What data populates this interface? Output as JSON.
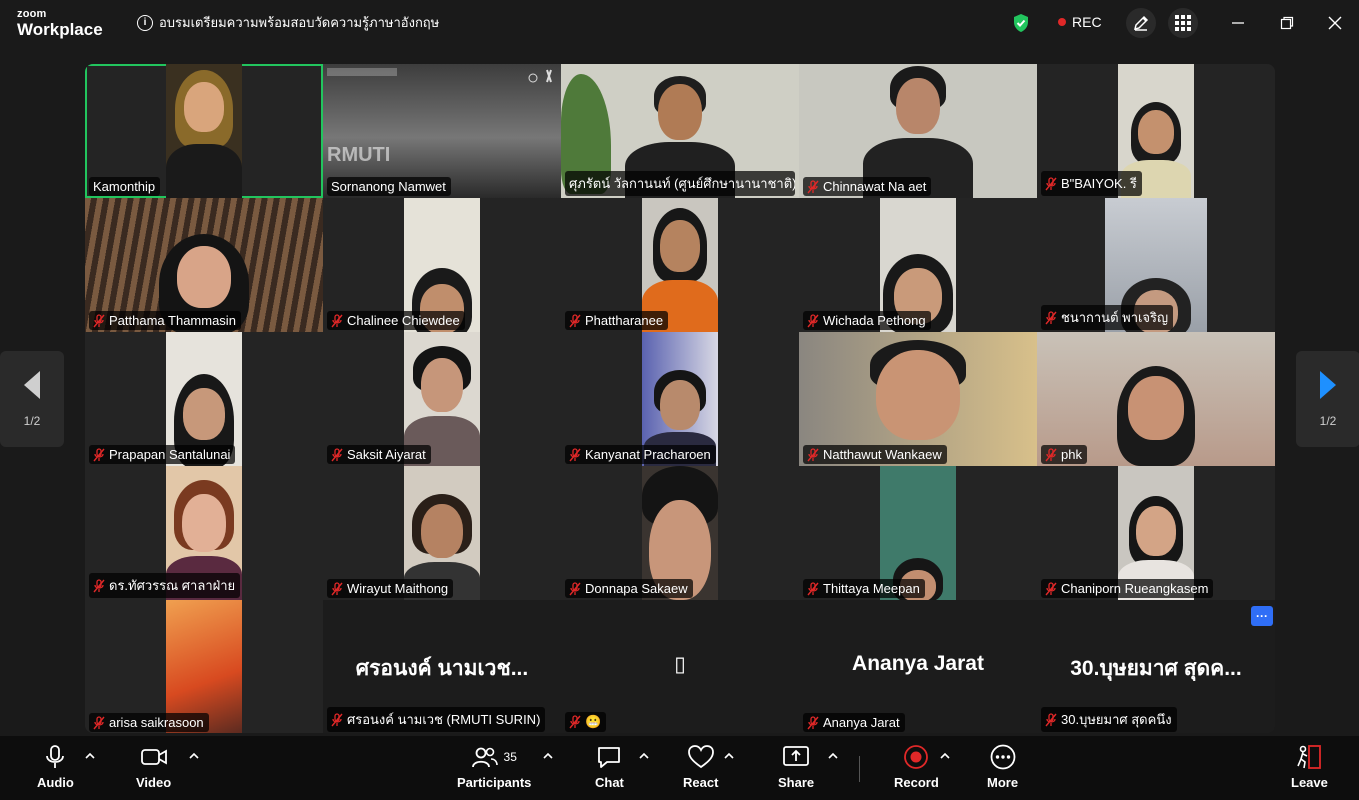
{
  "titlebar": {
    "logo_top": "zoom",
    "logo_bottom": "Workplace",
    "meeting_title": "อบรมเตรียมความพร้อมสอบวัดความรู้ภาษาอังกฤษ",
    "rec_label": "REC"
  },
  "pager": {
    "left_page": "1/2",
    "right_page": "1/2"
  },
  "participants": [
    {
      "name": "Kamonthip",
      "muted": false,
      "active": true
    },
    {
      "name": "Sornanong Namwet",
      "muted": false,
      "share_text": "RMUTI"
    },
    {
      "name": "ศุภรัตน์ วัลกานนท์ (ศูนย์ศึกษานานาชาติ)",
      "muted": false
    },
    {
      "name": "Chinnawat Na aet",
      "muted": true
    },
    {
      "name": "B\"BAIYOK. รี",
      "muted": true
    },
    {
      "name": "Patthama Thammasin",
      "muted": true
    },
    {
      "name": "Chalinee Chiewdee",
      "muted": true
    },
    {
      "name": "Phattharanee",
      "muted": true
    },
    {
      "name": "Wichada Pethong",
      "muted": true
    },
    {
      "name": "ชนากานต์ พาเจริญ",
      "muted": true
    },
    {
      "name": "Prapapan Santalunai",
      "muted": true
    },
    {
      "name": "Saksit Aiyarat",
      "muted": true
    },
    {
      "name": "Kanyanat Pracharoen",
      "muted": true
    },
    {
      "name": "Natthawut Wankaew",
      "muted": true
    },
    {
      "name": "phk",
      "muted": true
    },
    {
      "name": "ดร.ทัศวรรณ ศาลาฝ่าย",
      "muted": true
    },
    {
      "name": "Wirayut Maithong",
      "muted": true
    },
    {
      "name": "Donnapa Sakaew",
      "muted": true
    },
    {
      "name": "Thittaya Meepan",
      "muted": true
    },
    {
      "name": "Chaniporn Rueangkasem",
      "muted": true
    },
    {
      "name": "arisa saikrasoon",
      "muted": true
    },
    {
      "name": "ศรอนงค์ นามเวช (RMUTI SURIN)",
      "muted": true,
      "display_name": "ศรอนงค์ นามเวช..."
    },
    {
      "name": "😬",
      "muted": true,
      "display_name": "▯"
    },
    {
      "name": "Ananya Jarat",
      "muted": true,
      "display_name": "Ananya Jarat"
    },
    {
      "name": "30.บุษยมาศ สุดคนึง",
      "muted": true,
      "display_name": "30.บุษยมาศ สุดค..."
    }
  ],
  "more_badge": "···",
  "toolbar": {
    "audio": "Audio",
    "video": "Video",
    "participants": "Participants",
    "participants_count": "35",
    "chat": "Chat",
    "react": "React",
    "share": "Share",
    "record": "Record",
    "more": "More",
    "leave": "Leave"
  },
  "colors": {
    "accent_green": "#22c55e",
    "record_red": "#e02828",
    "pager_arrow_blue": "#1e90ff",
    "more_badge_blue": "#2f6ef6",
    "leave_red": "#e02828"
  }
}
